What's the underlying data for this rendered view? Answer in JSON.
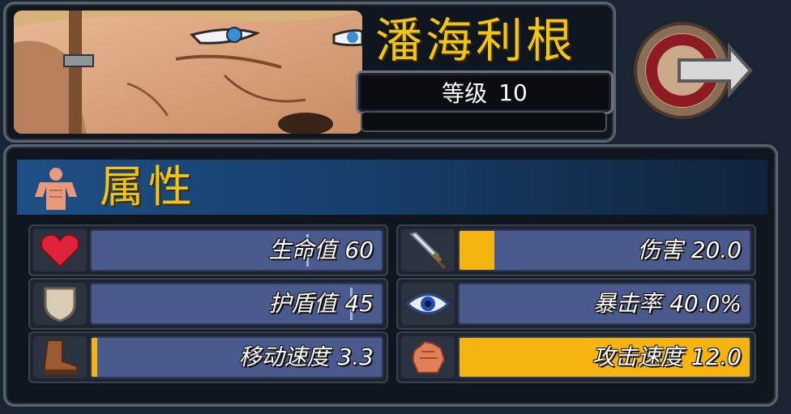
{
  "character": {
    "name": "潘海利根",
    "level_label": "等级",
    "level_value": "10"
  },
  "attributes_panel": {
    "title": "属性",
    "left_stats": [
      {
        "label": "生命值",
        "value": "60",
        "icon": "heart-icon",
        "fill_percent": 0,
        "tick_percent": 74
      },
      {
        "label": "护盾值",
        "value": "45",
        "icon": "shield-icon",
        "fill_percent": 0,
        "tick_percent": 89
      },
      {
        "label": "移动速度",
        "value": "3.3",
        "icon": "boot-icon",
        "fill_percent": 2,
        "tick_percent": 0
      }
    ],
    "right_stats": [
      {
        "label": "伤害",
        "value": "20.0",
        "icon": "sword-icon",
        "fill_percent": 12,
        "tick_percent": 0
      },
      {
        "label": "暴击率",
        "value": "40.0%",
        "icon": "eye-icon",
        "fill_percent": 0,
        "tick_percent": 0
      },
      {
        "label": "攻击速度",
        "value": "12.0",
        "icon": "fist-icon",
        "fill_percent": 100,
        "tick_percent": 0
      }
    ]
  },
  "colors": {
    "title_gold": "#f1c41a",
    "bar_blue": "#4a5a8c",
    "bar_fill": "#f5b40f",
    "header_blue": "#1d4f86"
  }
}
